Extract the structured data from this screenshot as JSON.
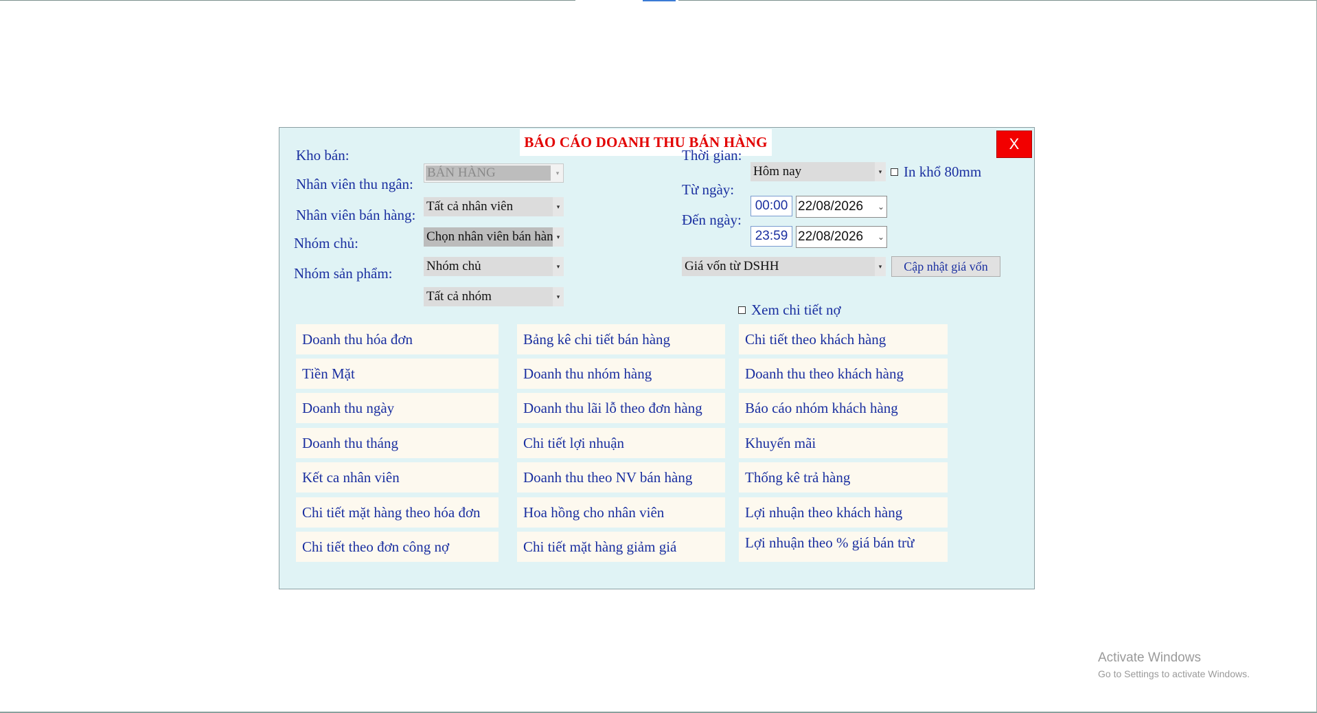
{
  "dialog": {
    "title": "BÁO CÁO DOANH THU BÁN HÀNG",
    "close_label": "X"
  },
  "filters": {
    "kho_ban": {
      "label": "Kho bán:",
      "value": "BÁN HÀNG"
    },
    "nv_thu_ngan": {
      "label": "Nhân viên thu ngân:",
      "value": "Tất cả nhân viên"
    },
    "nv_ban_hang": {
      "label": "Nhân viên bán hàng:",
      "value": "Chọn nhân viên bán hàng"
    },
    "nhom_chu": {
      "label": "Nhóm chủ:",
      "value": "Nhóm chủ"
    },
    "nhom_san_pham": {
      "label": "Nhóm sản phẩm:",
      "value": "Tất cả nhóm"
    },
    "thoi_gian": {
      "label": "Thời gian:",
      "value": "Hôm nay"
    },
    "in_kho": {
      "label": "In khổ 80mm",
      "checked": false
    },
    "tu_ngay": {
      "label": "Từ ngày:",
      "time": "00:00",
      "date": "22/08/2026"
    },
    "den_ngay": {
      "label": "Đến ngày:",
      "time": "23:59",
      "date": "22/08/2026"
    },
    "gia_von": {
      "value": "Giá vốn từ DSHH"
    },
    "cap_nhat_label": "Cập nhật giá vốn",
    "xem_chi_tiet_no": {
      "label": "Xem chi tiết nợ",
      "checked": false
    }
  },
  "reports": {
    "col1": [
      "Doanh thu hóa đơn",
      "Tiền Mặt",
      "Doanh thu  ngày",
      "Doanh thu tháng",
      "Kết ca nhân viên",
      "Chi tiết mặt hàng theo hóa đơn",
      "Chi tiết theo đơn công nợ"
    ],
    "col2": [
      "Bảng kê chi tiết bán hàng",
      "Doanh thu nhóm hàng",
      "Doanh thu lãi lỗ theo đơn hàng",
      "Chi tiết lợi nhuận",
      "Doanh thu theo NV bán hàng",
      "Hoa hồng cho nhân viên",
      "Chi tiết mặt hàng giảm giá"
    ],
    "col3": [
      "Chi tiết theo khách hàng",
      "Doanh thu theo khách hàng",
      "Báo cáo nhóm khách hàng",
      "Khuyến mãi",
      "Thống kê trả hàng",
      "Lợi nhuận theo khách hàng",
      "Lợi nhuận theo % giá bán trừ"
    ]
  },
  "watermark": {
    "line1": "Activate Windows",
    "line2": "Go to Settings to activate Windows."
  }
}
